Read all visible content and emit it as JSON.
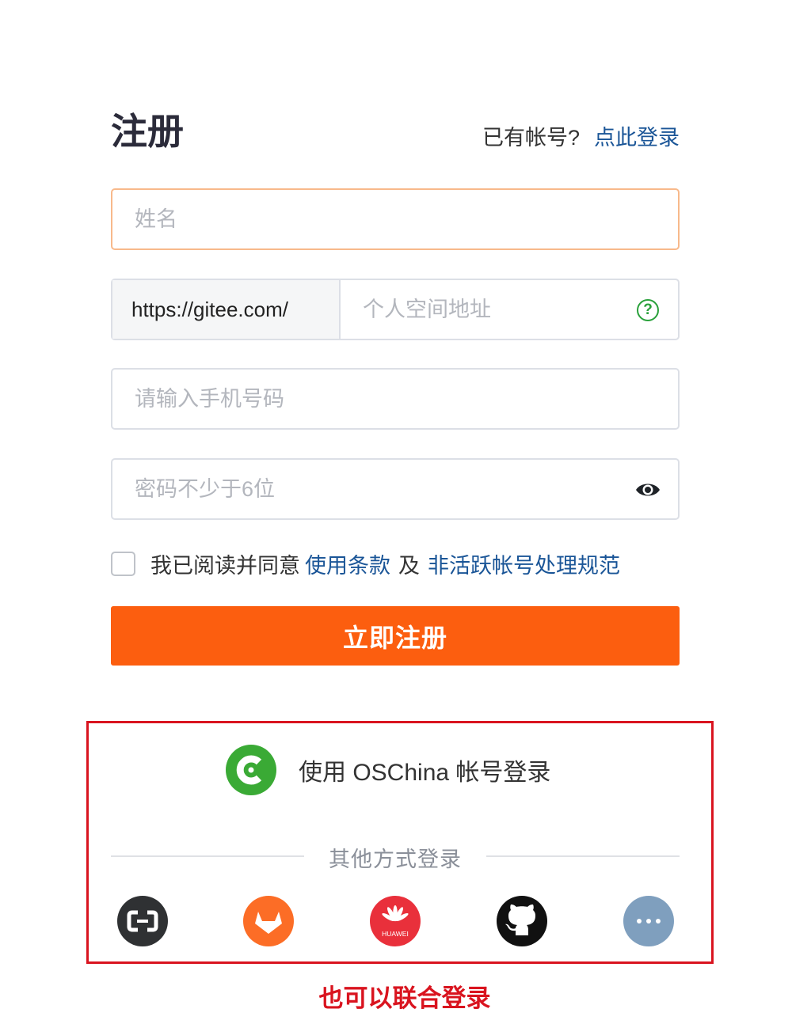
{
  "header": {
    "title": "注册",
    "have_account": "已有帐号?",
    "login_link": "点此登录"
  },
  "form": {
    "name_placeholder": "姓名",
    "space_prefix": "https://gitee.com/",
    "space_placeholder": "个人空间地址",
    "phone_placeholder": "请输入手机号码",
    "password_placeholder": "密码不少于6位",
    "agree_text": "我已阅读并同意",
    "terms_link": "使用条款",
    "and_text": "及",
    "policy_link": "非活跃帐号处理规范",
    "submit_label": "立即注册"
  },
  "oauth": {
    "oschina_label": "使用 OSChina 帐号登录",
    "other_methods": "其他方式登录",
    "providers": [
      "aliyun-icon",
      "gitlab-icon",
      "huawei-icon",
      "github-icon",
      "more-icon"
    ],
    "huawei_text": "HUAWEI"
  },
  "annotation": {
    "caption": "也可以联合登录"
  },
  "colors": {
    "accent": "#fc5e0f",
    "link": "#1a5597",
    "annotation_red": "#d9141f",
    "oschina_green": "#3aaa35"
  }
}
